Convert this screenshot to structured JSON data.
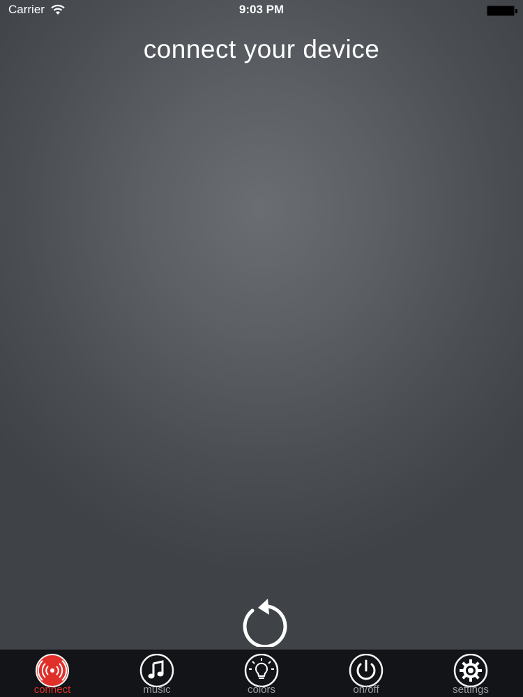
{
  "status_bar": {
    "carrier": "Carrier",
    "time": "9:03 PM"
  },
  "main": {
    "title": "connect your device",
    "refresh_icon": "refresh-icon"
  },
  "tabs": [
    {
      "label": "connect",
      "icon": "broadcast-icon",
      "active": true
    },
    {
      "label": "music",
      "icon": "music-note-icon",
      "active": false
    },
    {
      "label": "colors",
      "icon": "lightbulb-icon",
      "active": false
    },
    {
      "label": "on/off",
      "icon": "power-icon",
      "active": false
    },
    {
      "label": "settings",
      "icon": "gear-icon",
      "active": false
    }
  ],
  "colors": {
    "accent": "#e0302a",
    "tab_bar": "#121417",
    "inactive_label": "#9a9ca0"
  }
}
